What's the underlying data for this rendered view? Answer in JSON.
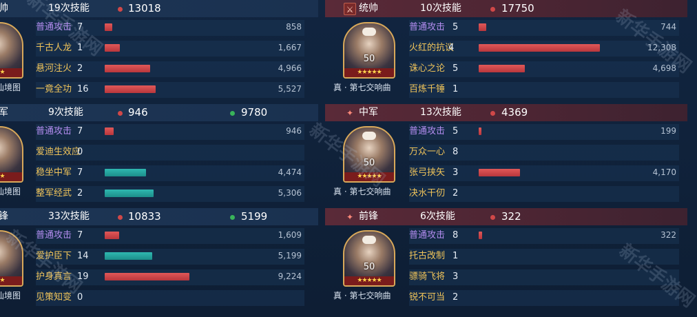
{
  "watermark": "新华手游网",
  "left": [
    {
      "role": "帅",
      "skills": "19次技能",
      "damage": "13018",
      "heal": "",
      "portrait_level": "",
      "portrait_stars": "★★★",
      "card": "仙境图",
      "rows": [
        {
          "name": "普通攻击",
          "type": "normal",
          "count": "7",
          "value": "858",
          "bar": 0.07,
          "kind": "dmg"
        },
        {
          "name": "千古人龙",
          "type": "skill",
          "count": "1",
          "value": "1,667",
          "bar": 0.135,
          "kind": "dmg"
        },
        {
          "name": "悬河注火",
          "type": "skill",
          "count": "2",
          "value": "4,966",
          "bar": 0.405,
          "kind": "dmg"
        },
        {
          "name": "一竟全功",
          "type": "skill",
          "count": "16",
          "value": "5,527",
          "bar": 0.45,
          "kind": "dmg"
        }
      ]
    },
    {
      "role": "军",
      "skills": "9次技能",
      "damage": "946",
      "heal": "9780",
      "portrait_level": "",
      "portrait_stars": "★★★",
      "card": "仙境图",
      "rows": [
        {
          "name": "普通攻击",
          "type": "normal",
          "count": "7",
          "value": "946",
          "bar": 0.077,
          "kind": "dmg"
        },
        {
          "name": "爱迪生效应",
          "type": "skill",
          "count": "0",
          "value": "",
          "bar": 0,
          "kind": "dmg"
        },
        {
          "name": "稳坐中军",
          "type": "skill",
          "count": "7",
          "value": "4,474",
          "bar": 0.365,
          "kind": "heal"
        },
        {
          "name": "整军经武",
          "type": "skill",
          "count": "2",
          "value": "5,306",
          "bar": 0.43,
          "kind": "heal"
        }
      ]
    },
    {
      "role": "锋",
      "skills": "33次技能",
      "damage": "10833",
      "heal": "5199",
      "portrait_level": "",
      "portrait_stars": "★★★",
      "card": "仙境图",
      "rows": [
        {
          "name": "普通攻击",
          "type": "normal",
          "count": "7",
          "value": "1,609",
          "bar": 0.13,
          "kind": "dmg"
        },
        {
          "name": "爱护臣下",
          "type": "skill",
          "count": "14",
          "value": "5,199",
          "bar": 0.42,
          "kind": "heal"
        },
        {
          "name": "护身真言",
          "type": "skill",
          "count": "19",
          "value": "9,224",
          "bar": 0.75,
          "kind": "dmg"
        },
        {
          "name": "见策知变",
          "type": "skill",
          "count": "0",
          "value": "",
          "bar": 0,
          "kind": "dmg"
        }
      ]
    }
  ],
  "right": [
    {
      "role": "统帅",
      "icon": "⚔",
      "skills": "10次技能",
      "damage": "17750",
      "portrait_level": "50",
      "portrait_stars": "★★★★★",
      "card": "真 · 第七交响曲",
      "rows": [
        {
          "name": "普通攻击",
          "type": "normal",
          "count": "5",
          "value": "744",
          "bar": 0.06,
          "kind": "dmg"
        },
        {
          "name": "火红的抗议",
          "type": "skill",
          "count": "4",
          "value": "12,308",
          "bar": 1.0,
          "kind": "dmg"
        },
        {
          "name": "诛心之论",
          "type": "skill",
          "count": "5",
          "value": "4,698",
          "bar": 0.38,
          "kind": "dmg"
        },
        {
          "name": "百炼千锤",
          "type": "skill",
          "count": "1",
          "value": "",
          "bar": 0,
          "kind": "dmg"
        }
      ]
    },
    {
      "role": "中军",
      "icon": "✦",
      "skills": "13次技能",
      "damage": "4369",
      "portrait_level": "50",
      "portrait_stars": "★★★★★",
      "card": "真 · 第七交响曲",
      "rows": [
        {
          "name": "普通攻击",
          "type": "normal",
          "count": "5",
          "value": "199",
          "bar": 0.016,
          "kind": "dmg"
        },
        {
          "name": "万众一心",
          "type": "skill",
          "count": "8",
          "value": "",
          "bar": 0,
          "kind": "dmg"
        },
        {
          "name": "张弓挟矢",
          "type": "skill",
          "count": "3",
          "value": "4,170",
          "bar": 0.34,
          "kind": "dmg"
        },
        {
          "name": "决水干仞",
          "type": "skill",
          "count": "2",
          "value": "",
          "bar": 0,
          "kind": "dmg"
        }
      ]
    },
    {
      "role": "前锋",
      "icon": "✦",
      "skills": "6次技能",
      "damage": "322",
      "portrait_level": "50",
      "portrait_stars": "★★★★★",
      "card": "真 · 第七交响曲",
      "rows": [
        {
          "name": "普通攻击",
          "type": "normal",
          "count": "8",
          "value": "322",
          "bar": 0.026,
          "kind": "dmg"
        },
        {
          "name": "托古改制",
          "type": "skill",
          "count": "1",
          "value": "",
          "bar": 0,
          "kind": "dmg"
        },
        {
          "name": "骠骑飞将",
          "type": "skill",
          "count": "3",
          "value": "",
          "bar": 0,
          "kind": "dmg"
        },
        {
          "name": "锐不可当",
          "type": "skill",
          "count": "2",
          "value": "",
          "bar": 0,
          "kind": "dmg"
        }
      ]
    }
  ]
}
